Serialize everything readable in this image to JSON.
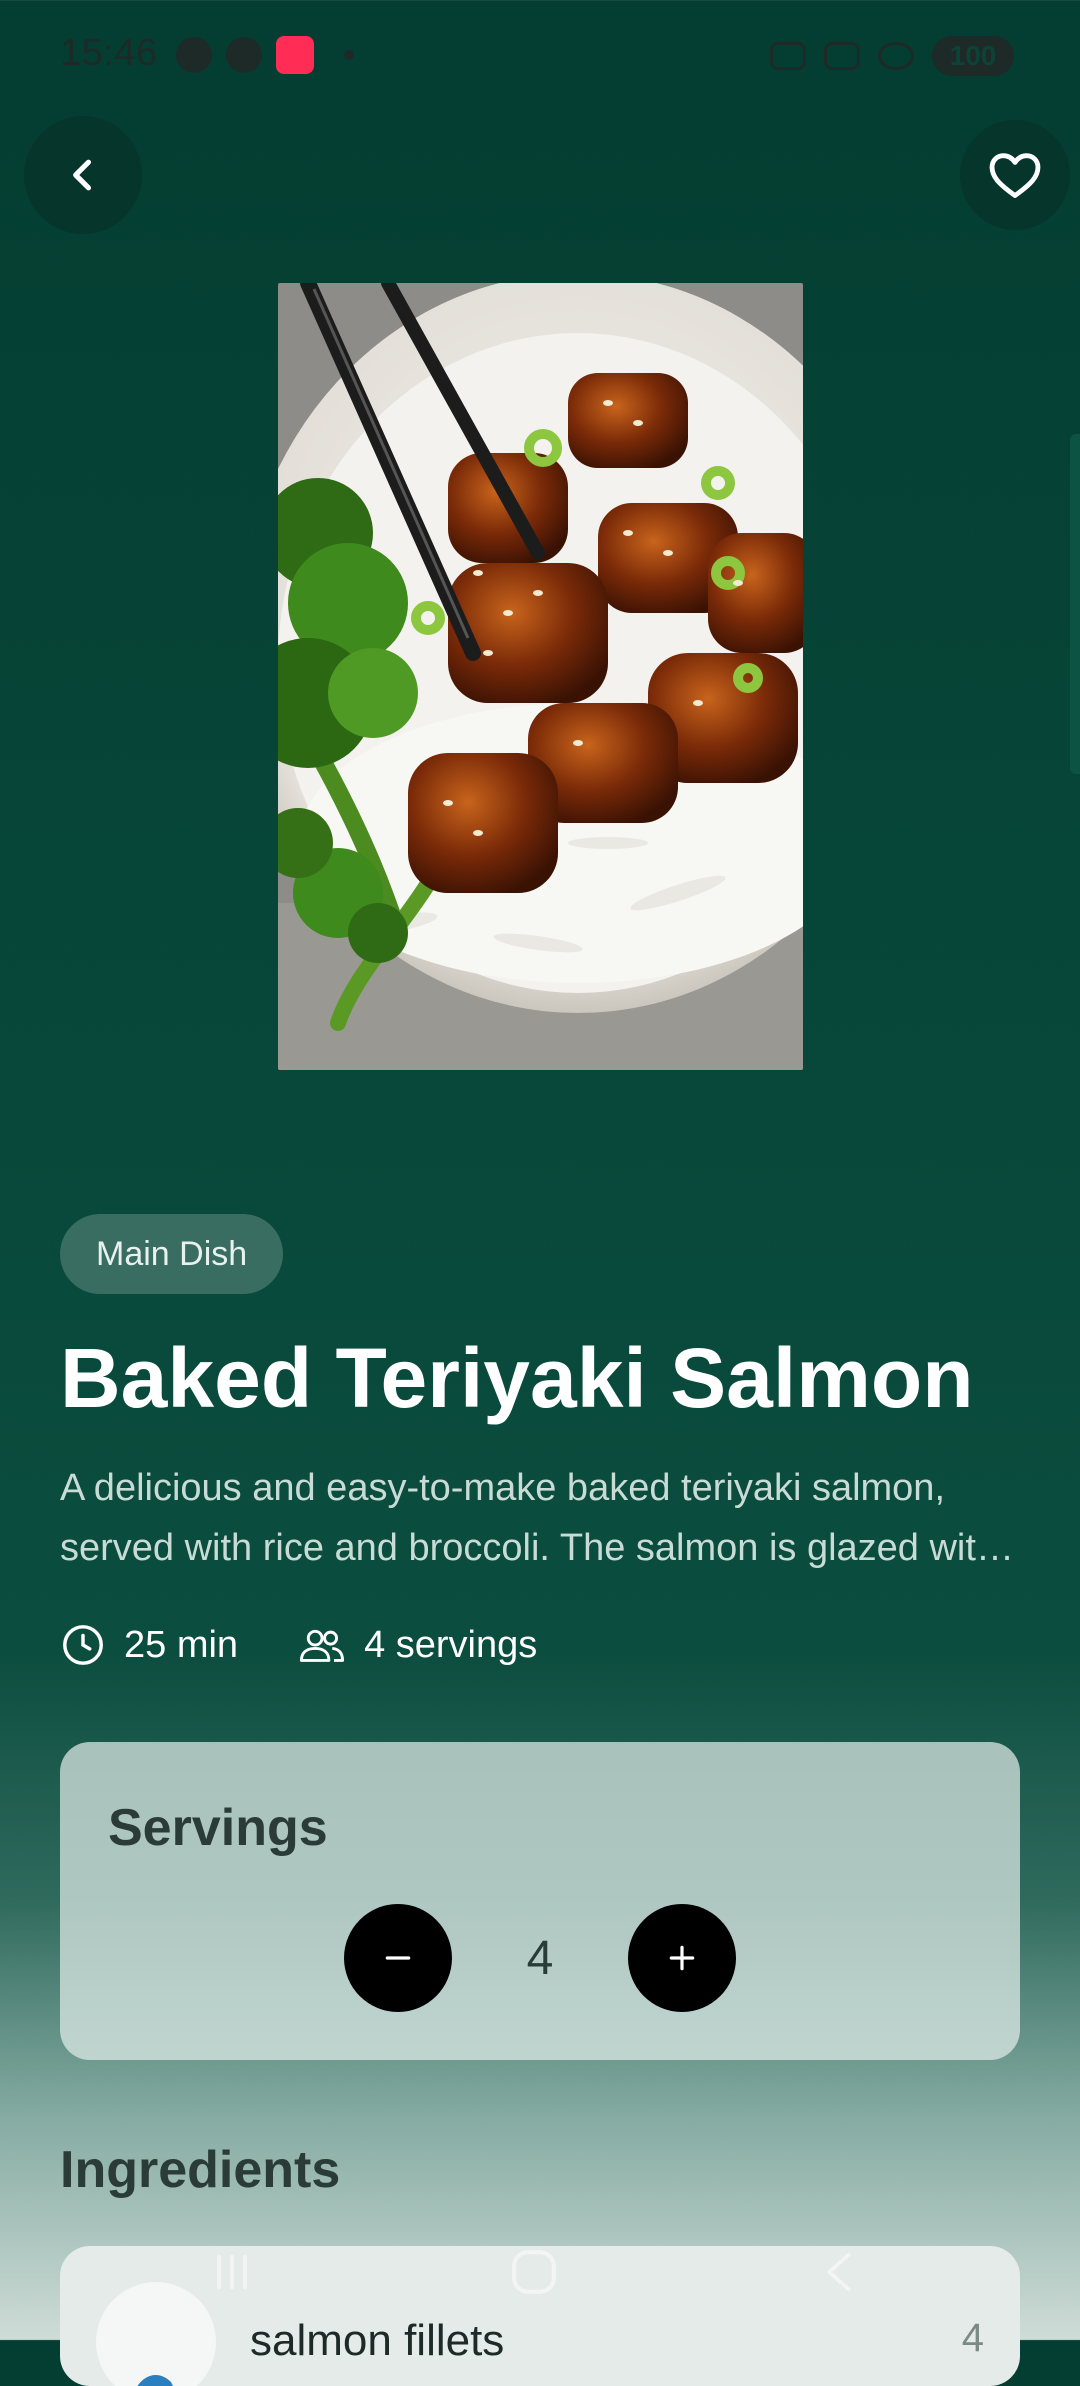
{
  "status_bar": {
    "time": "15:46",
    "battery": "100"
  },
  "recipe": {
    "category": "Main Dish",
    "title": "Baked Teriyaki Salmon",
    "description": "A delicious and easy-to-make baked teriyaki salmon, served with rice and broccoli. The salmon is glazed with a homemade teriyaki sauce and baked until tender and flaky.",
    "time": "25 min",
    "servings_label": "4 servings"
  },
  "servings_card": {
    "title": "Servings",
    "value": "4"
  },
  "ingredients": {
    "title": "Ingredients",
    "items": [
      {
        "name": "salmon fillets",
        "quantity": "4"
      }
    ]
  },
  "icons": {
    "back": "chevron-left-icon",
    "favorite": "heart-outline-icon",
    "time": "clock-icon",
    "servings": "people-icon",
    "decrease": "minus-icon",
    "increase": "plus-icon"
  },
  "colors": {
    "background_top": "#043d31",
    "background_bottom": "#cfdcd7",
    "chip": "#3a6d61",
    "stepper_button": "#000000"
  }
}
